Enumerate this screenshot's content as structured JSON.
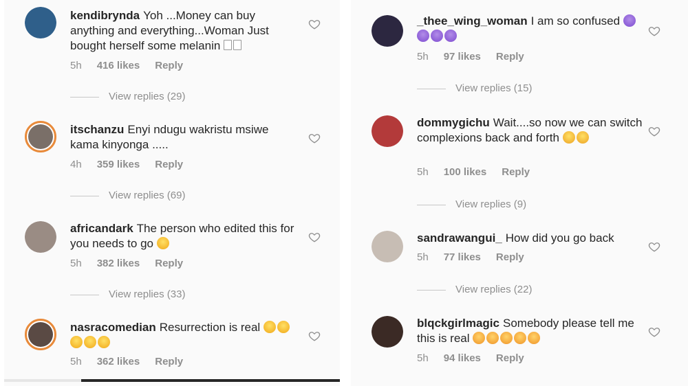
{
  "left": [
    {
      "user": "kendibrynda",
      "text": "Yoh ...Money can buy anything and everything...Woman Just bought herself some melanin",
      "emoji": [
        "box",
        "box"
      ],
      "time": "5h",
      "likes": "416 likes",
      "reply": "Reply",
      "view_replies": "View replies (29)",
      "avatar_color": "#2f5f8a",
      "story": false
    },
    {
      "user": "itschanzu",
      "text": "Enyi ndugu wakristu msiwe kama kinyonga .....",
      "emoji": [],
      "time": "4h",
      "likes": "359 likes",
      "reply": "Reply",
      "view_replies": "View replies (69)",
      "avatar_color": "#7a6f68",
      "story": true
    },
    {
      "user": "africandark",
      "text": "The person who edited this for you needs to go",
      "emoji": [
        "laugh"
      ],
      "time": "5h",
      "likes": "382 likes",
      "reply": "Reply",
      "view_replies": "View replies (33)",
      "avatar_color": "#9a8c84",
      "story": false
    },
    {
      "user": "nasracomedian",
      "text": "Resurrection is real",
      "emoji": [
        "laugh",
        "laugh",
        "laugh",
        "laugh",
        "laugh"
      ],
      "time": "5h",
      "likes": "362 likes",
      "reply": "Reply",
      "view_replies": "",
      "avatar_color": "#5a4a44",
      "story": true
    }
  ],
  "right": [
    {
      "user": "_thee_wing_woman",
      "text": "I am so confused",
      "emoji": [
        "woman",
        "woman",
        "woman",
        "woman"
      ],
      "time": "5h",
      "likes": "97 likes",
      "reply": "Reply",
      "view_replies": "View replies (15)",
      "avatar_color": "#2c2740",
      "story": false
    },
    {
      "user": "dommygichu",
      "text": "Wait....so now we can switch complexions back and forth",
      "emoji": [
        "think",
        "think"
      ],
      "time": "5h",
      "likes": "100 likes",
      "reply": "Reply",
      "view_replies": "View replies (9)",
      "avatar_color": "#b33a3a",
      "story": false
    },
    {
      "user": "sandrawangui_",
      "text": "How did you go back",
      "emoji": [],
      "time": "5h",
      "likes": "77 likes",
      "reply": "Reply",
      "view_replies": "View replies (22)",
      "avatar_color": "#c7bdb4",
      "story": false
    },
    {
      "user": "blqckgirlmagic",
      "text": "Somebody please tell me this is real",
      "emoji": [
        "smile",
        "smile",
        "smile",
        "smile",
        "smile"
      ],
      "time": "5h",
      "likes": "94 likes",
      "reply": "Reply",
      "view_replies": "",
      "avatar_color": "#3b2a25",
      "story": false
    }
  ],
  "icons": {
    "heart": "heart-outline-icon"
  },
  "colors": {
    "meta": "#8e8e8e",
    "text": "#262626",
    "story_ring": "#e88a3a"
  }
}
